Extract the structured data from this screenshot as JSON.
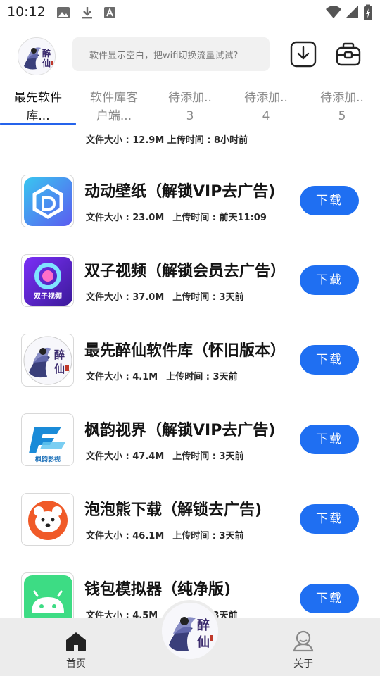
{
  "status_bar": {
    "time": "10:12"
  },
  "header": {
    "search_placeholder": "软件显示空白，把wifi切换流量试试?",
    "logo_text_top": "醉",
    "logo_text_bottom": "仙"
  },
  "tabs": [
    {
      "line1": "最先软件",
      "line2": "库..."
    },
    {
      "line1": "软件库客",
      "line2": "户端..."
    },
    {
      "line1": "待添加..",
      "line2": "3"
    },
    {
      "line1": "待添加..",
      "line2": "4"
    },
    {
      "line1": "待添加..",
      "line2": "5"
    }
  ],
  "partial_item": {
    "meta": "文件大小 : 12.9M    上传时间 : 8小时前"
  },
  "items": [
    {
      "title": "动动壁纸（解锁VIP去广告)",
      "size": "文件大小 : 23.0M",
      "time": "上传时间 : 前天11:09",
      "button": "下载",
      "icon": "wallpaper-app-icon"
    },
    {
      "title": "双子视频（解锁会员去广告）",
      "size": "文件大小 : 37.0M",
      "time": "上传时间 : 3天前",
      "button": "下载",
      "icon": "video-app-icon",
      "icon_text": "双子视频"
    },
    {
      "title": "最先醉仙软件库（怀旧版本）",
      "size": "文件大小 : 4.1M",
      "time": "上传时间 : 3天前",
      "button": "下载",
      "icon": "zuixian-app-icon"
    },
    {
      "title": "枫韵视界（解锁VIP去广告)",
      "size": "文件大小 : 47.4M",
      "time": "上传时间 : 3天前",
      "button": "下载",
      "icon": "fengyun-app-icon",
      "icon_text": "枫韵影视"
    },
    {
      "title": "泡泡熊下载（解锁去广告)",
      "size": "文件大小 : 46.1M",
      "time": "上传时间 : 3天前",
      "button": "下载",
      "icon": "bear-app-icon"
    },
    {
      "title": "钱包模拟器（纯净版)",
      "size": "文件大小 : 4.5M",
      "time": "上传时间 : 3天前",
      "button": "下载",
      "icon": "android-app-icon"
    }
  ],
  "bottom_nav": {
    "home": "首页",
    "about": "关于"
  },
  "colors": {
    "accent": "#1f6ff2",
    "tab_underline": "#2563eb"
  }
}
